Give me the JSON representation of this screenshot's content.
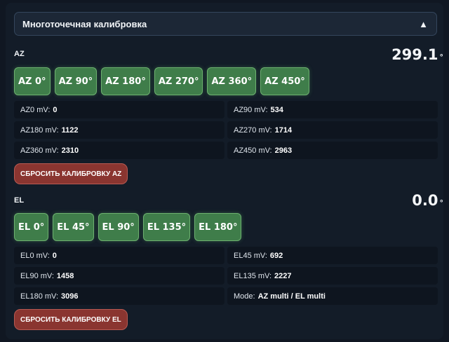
{
  "accordion": {
    "title": "Многоточечная калибровка",
    "toggle_icon": "▲"
  },
  "az": {
    "label": "AZ",
    "angle_value": "299.1",
    "angle_unit": "°",
    "buttons": [
      "AZ 0°",
      "AZ 90°",
      "AZ 180°",
      "AZ 270°",
      "AZ 360°",
      "AZ 450°"
    ],
    "readings": [
      {
        "label": "AZ0 mV:",
        "value": "0"
      },
      {
        "label": "AZ90 mV:",
        "value": "534"
      },
      {
        "label": "AZ180 mV:",
        "value": "1122"
      },
      {
        "label": "AZ270 mV:",
        "value": "1714"
      },
      {
        "label": "AZ360 mV:",
        "value": "2310"
      },
      {
        "label": "AZ450 mV:",
        "value": "2963"
      }
    ],
    "reset_label": "СБРОСИТЬ КАЛИБРОВКУ AZ"
  },
  "el": {
    "label": "EL",
    "angle_value": "0.0",
    "angle_unit": "°",
    "buttons": [
      "EL 0°",
      "EL 45°",
      "EL 90°",
      "EL 135°",
      "EL 180°"
    ],
    "readings": [
      {
        "label": "EL0 mV:",
        "value": "0"
      },
      {
        "label": "EL45 mV:",
        "value": "692"
      },
      {
        "label": "EL90 mV:",
        "value": "1458"
      },
      {
        "label": "EL135 mV:",
        "value": "2227"
      },
      {
        "label": "EL180 mV:",
        "value": "3096"
      },
      {
        "label": "Mode:",
        "value": "AZ multi / EL multi"
      }
    ],
    "reset_label": "СБРОСИТЬ КАЛИБРОВКУ EL"
  },
  "colors": {
    "background": "#101722",
    "calibrate_button": "#3f7d4a",
    "reset_button": "#8a3530"
  }
}
